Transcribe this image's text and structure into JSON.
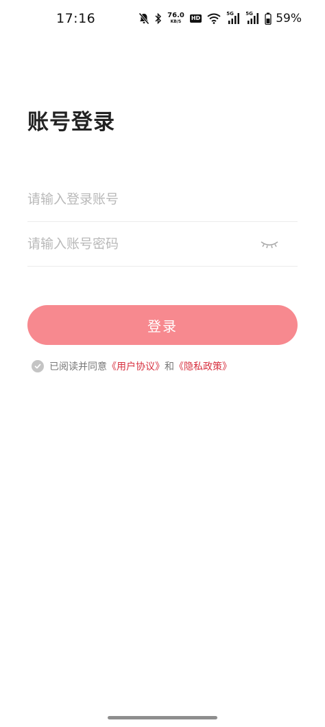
{
  "status_bar": {
    "time": "17:16",
    "net_speed_value": "76.0",
    "net_speed_unit": "KB/S",
    "hd_label": "HD",
    "signal1_label": "5G",
    "signal2_label": "5G",
    "battery": "59%",
    "icons": [
      "mute-bell-icon",
      "bluetooth-icon",
      "wifi-icon",
      "cell-signal-icon",
      "battery-icon"
    ]
  },
  "title": "账号登录",
  "form": {
    "account_placeholder": "请输入登录账号",
    "account_value": "",
    "password_placeholder": "请输入账号密码",
    "password_value": "",
    "password_toggle_icon": "eye-closed-icon"
  },
  "login_button": {
    "label": "登录"
  },
  "agreement": {
    "prefix": "已阅读并同意",
    "user_agreement": "《用户协议》",
    "conjunction": "和",
    "privacy_policy": "《隐私政策》"
  },
  "colors": {
    "accent": "#f7898f",
    "link": "#d7303f",
    "placeholder": "#b9b9b9",
    "divider": "#ececec"
  }
}
